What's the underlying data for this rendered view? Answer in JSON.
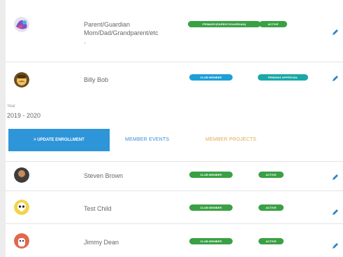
{
  "members": [
    {
      "name": "Parent/Guardian\nMom/Dad/Grandparent/etc\n.",
      "avatar_icon": "mixed-color-avatar-icon",
      "badges": [
        "PRIMARY(PARENT/GUARDIAN)",
        "ACTIVE"
      ]
    },
    {
      "name": "Billy Bob",
      "avatar_icon": "mustache-face-avatar-icon",
      "badges": [
        "CLUB MEMBER",
        "PENDING APPROVAL"
      ]
    }
  ],
  "enrollment": {
    "year_label": "Year",
    "year_value": "2019 - 2020",
    "update_button": "> UPDATE ENROLLMENT",
    "tabs": [
      "MEMBER EVENTS",
      "MEMBER PROJECTS"
    ]
  },
  "children": [
    {
      "name": "Steven Brown",
      "avatar_icon": "bearded-man-avatar-icon",
      "badges": [
        "CLUB MEMBER",
        "ACTIVE"
      ]
    },
    {
      "name": "Test Child",
      "avatar_icon": "skull-avatar-icon",
      "badges": [
        "CLUB MEMBER",
        "ACTIVE"
      ]
    },
    {
      "name": "Jimmy Dean",
      "avatar_icon": "cartoon-avatar-icon",
      "badges": [
        "CLUB MEMBER",
        "ACTIVE"
      ]
    }
  ],
  "colors": {
    "active_green": "#3aa045",
    "member_blue": "#1d9fd8",
    "pending_teal": "#1aa7a8",
    "button_blue": "#2f95d9",
    "events_blue": "#3a8fd6",
    "projects_orange": "#e6a94c"
  }
}
